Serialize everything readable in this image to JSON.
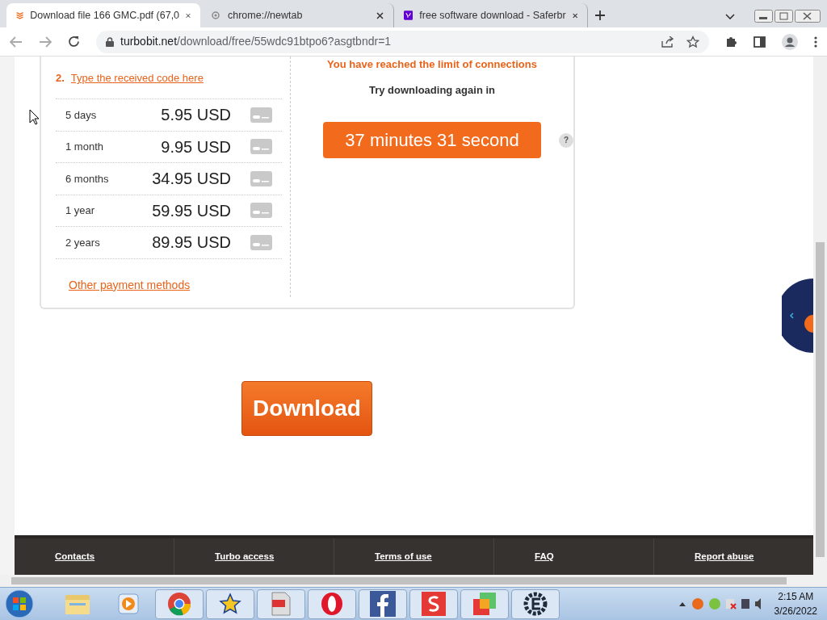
{
  "tabs": [
    {
      "title": "Download file 166 GMC.pdf (67,0",
      "selected": true,
      "kind": "turbobit"
    },
    {
      "title": "chrome://newtab",
      "selected": false,
      "kind": "newtab"
    },
    {
      "title": "free software download - Saferbr",
      "selected": false,
      "kind": "yahoo"
    }
  ],
  "address": {
    "url_host": "turbobit.net",
    "url_path": "/download/free/55wdc91btpo6?asgtbndr=1"
  },
  "payment": {
    "step_number": "2.",
    "step_link": "Type the received code here",
    "plans": [
      {
        "period": "5 days",
        "price": "5.95 USD"
      },
      {
        "period": "1 month",
        "price": "9.95 USD"
      },
      {
        "period": "6 months",
        "price": "34.95 USD"
      },
      {
        "period": "1 year",
        "price": "59.95 USD"
      },
      {
        "period": "2 years",
        "price": "89.95 USD"
      }
    ],
    "other_link": "Other payment methods"
  },
  "limit": {
    "message": "You have reached the limit of connections",
    "retry_label": "Try downloading again in",
    "countdown": "37 minutes 31 second",
    "help": "?"
  },
  "download_button": "Download",
  "footer_links": [
    "Contacts",
    "Turbo access",
    "Terms of use",
    "FAQ",
    "Report abuse"
  ],
  "taskbar": {
    "apps": [
      {
        "kind": "explorer",
        "boxed": false
      },
      {
        "kind": "media",
        "boxed": false
      },
      {
        "kind": "chrome",
        "boxed": true
      },
      {
        "kind": "star",
        "boxed": true
      },
      {
        "kind": "pdf",
        "boxed": true
      },
      {
        "kind": "opera",
        "boxed": true
      },
      {
        "kind": "facebook",
        "boxed": true
      },
      {
        "kind": "s",
        "boxed": true
      },
      {
        "kind": "squares",
        "boxed": true
      },
      {
        "kind": "e",
        "boxed": true
      }
    ],
    "time": "2:15 AM",
    "date": "3/26/2022"
  }
}
